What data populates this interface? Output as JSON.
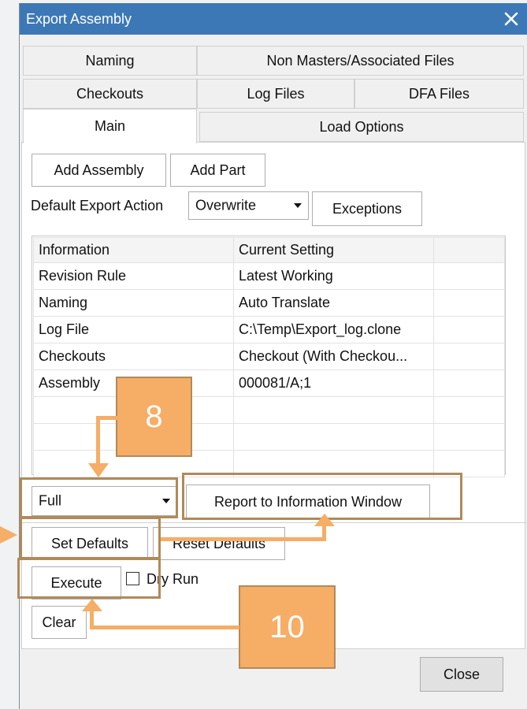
{
  "window": {
    "title": "Export Assembly"
  },
  "tabs": {
    "row1": [
      "Naming",
      "Non Masters/Associated Files"
    ],
    "row2": [
      "Checkouts",
      "Log Files",
      "DFA Files"
    ],
    "row3": [
      "Main",
      "Load Options"
    ],
    "active": "Main"
  },
  "main": {
    "add_assembly": "Add Assembly",
    "add_part": "Add Part",
    "default_export_label": "Default Export Action",
    "default_export_value": "Overwrite",
    "exceptions": "Exceptions",
    "table": {
      "headers": [
        "Information",
        "Current Setting",
        ""
      ],
      "rows": [
        [
          "Revision Rule",
          "Latest Working",
          ""
        ],
        [
          "Naming",
          "Auto Translate",
          ""
        ],
        [
          "Log File",
          "C:\\Temp\\Export_log.clone",
          ""
        ],
        [
          "Checkouts",
          "Checkout (With Checkou...",
          ""
        ],
        [
          "Assembly",
          "000081/A;1",
          ""
        ],
        [
          "",
          "",
          ""
        ],
        [
          "",
          "",
          ""
        ],
        [
          "",
          "",
          ""
        ]
      ]
    },
    "report_mode": "Full",
    "report_button": "Report to Information Window",
    "set_defaults": "Set Defaults",
    "reset_defaults": "Reset Defaults",
    "execute": "Execute",
    "dry_run": "Dry Run",
    "dry_run_checked": false,
    "clear": "Clear",
    "close": "Close"
  },
  "annotations": {
    "callout_8": "8",
    "callout_10": "10",
    "color": "#f6ad66",
    "border_color": "#b08a5a"
  }
}
